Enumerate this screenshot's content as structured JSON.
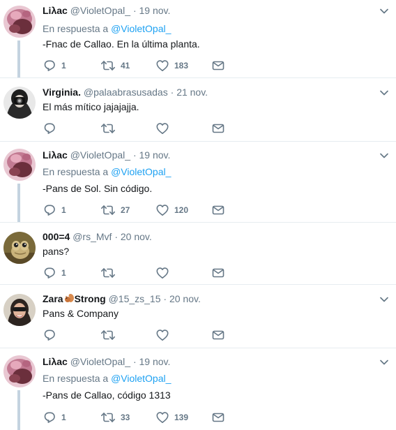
{
  "tweets": [
    {
      "name": "Liλac",
      "handle": "@VioletOpal_",
      "dot": "·",
      "time": "19 nov.",
      "replying_prefix": "En respuesta a",
      "replying_to": "@VioletOpal_",
      "text": "-Fnac de Callao. En la última planta.",
      "replies": "1",
      "retweets": "41",
      "likes": "183",
      "avatar": "lilac-avatar"
    },
    {
      "name": "Virginia.",
      "handle": "@palaabrasusadas",
      "dot": "·",
      "time": "21 nov.",
      "text": "El más mítico jajajajja.",
      "replies": "",
      "retweets": "",
      "likes": "",
      "avatar": "virginia-avatar"
    },
    {
      "name": "Liλac",
      "handle": "@VioletOpal_",
      "dot": "·",
      "time": "19 nov.",
      "replying_prefix": "En respuesta a",
      "replying_to": "@VioletOpal_",
      "text": "-Pans de Sol. Sin código.",
      "replies": "1",
      "retweets": "27",
      "likes": "120",
      "avatar": "lilac-avatar"
    },
    {
      "name": "000=4",
      "handle": "@rs_Mvf",
      "dot": "·",
      "time": "20 nov.",
      "text": "pans?",
      "replies": "1",
      "retweets": "",
      "likes": "",
      "avatar": "frog-avatar"
    },
    {
      "name_part1": "Zara",
      "name_emoji": "squirrel-emoji",
      "name_part2": "Strong",
      "handle": "@15_zs_15",
      "dot": "·",
      "time": "20 nov.",
      "text": "Pans & Company",
      "replies": "",
      "retweets": "",
      "likes": "",
      "avatar": "zara-avatar"
    },
    {
      "name": "Liλac",
      "handle": "@VioletOpal_",
      "dot": "·",
      "time": "19 nov.",
      "replying_prefix": "En respuesta a",
      "replying_to": "@VioletOpal_",
      "text": "-Pans de Callao, código 1313",
      "replies": "1",
      "retweets": "33",
      "likes": "139",
      "avatar": "lilac-avatar"
    }
  ],
  "colors": {
    "link": "#1da1f2",
    "muted": "#657786",
    "separator": "#e6ecf0",
    "thread_line": "#c4d3e0"
  }
}
